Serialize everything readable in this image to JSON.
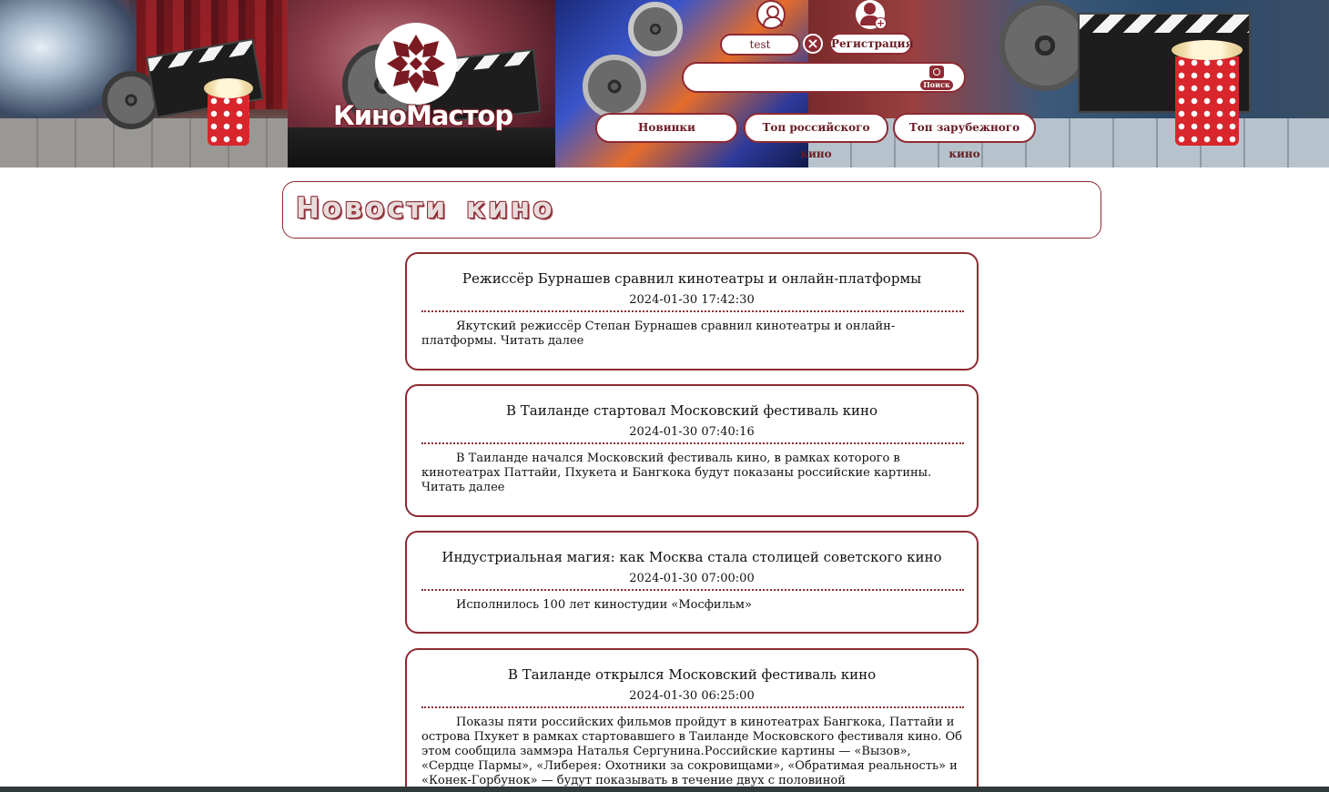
{
  "header": {
    "logo_text": "КиноМастор",
    "user": {
      "username": "test",
      "logout_icon": "close-icon"
    },
    "register_label": "Регистрация",
    "search": {
      "value": "",
      "placeholder": "",
      "button_label": "Поиск"
    },
    "nav": [
      {
        "label": "Новинки"
      },
      {
        "label": "Топ российского кино"
      },
      {
        "label": "Топ зарубежного кино"
      }
    ]
  },
  "colors": {
    "accent": "#8e2a33",
    "background": "#ffffff"
  },
  "page": {
    "title": "Новости кино"
  },
  "news": [
    {
      "title": "Режиссёр Бурнашев сравнил кинотеатры и онлайн-платформы",
      "date": "2024-01-30 17:42:30",
      "text": "Якутский режиссёр Степан Бурнашев сравнил кинотеатры и онлайн-платформы. Читать далее"
    },
    {
      "title": "В Таиланде стартовал Московский фестиваль кино",
      "date": "2024-01-30 07:40:16",
      "text": "В Таиланде начался Московский фестиваль кино, в рамках которого в кинотеатрах Паттайи, Пхукета и Бангкока будут показаны российские картины. Читать далее"
    },
    {
      "title": "Индустриальная магия: как Москва стала столицей советского кино",
      "date": "2024-01-30 07:00:00",
      "text": "Исполнилось 100 лет киностудии «Мосфильм»"
    },
    {
      "title": "В Таиланде открылся Московский фестиваль кино",
      "date": "2024-01-30 06:25:00",
      "text": "Показы пяти российских фильмов пройдут в кинотеатрах Бангкока, Паттайи и острова Пхукет в рамках стартовавшего в Таиланде Московского фестиваля кино. Об этом сообщила заммэра Наталья Сергунина.Российские картины — «Вызов», «Сердце Пармы», «Либерея: Охотники за сокровищами», «Обратимая реальность» и «Конек-Горбунок» — будут показывать в течение двух с половиной месяцев.«Открытие"
    }
  ]
}
